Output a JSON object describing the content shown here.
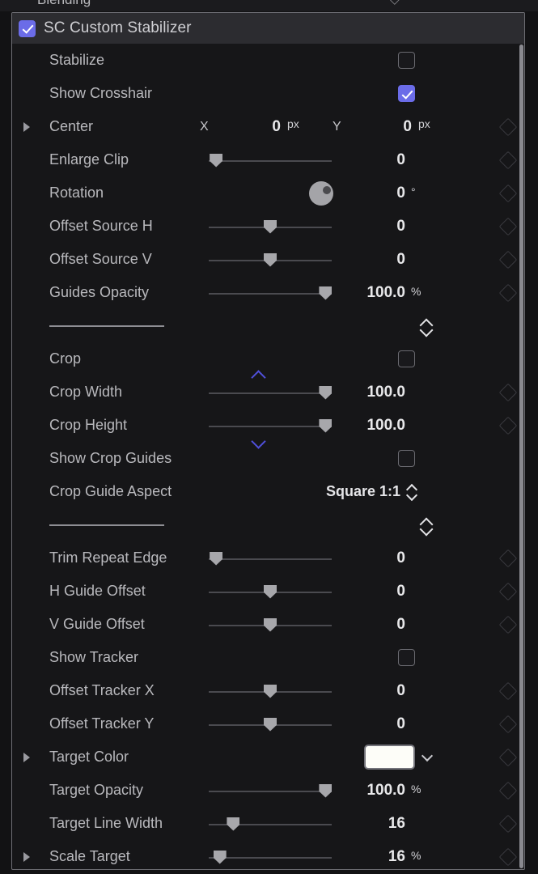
{
  "pre_row": {
    "label": "Blending",
    "keyframe_icon": "keyframe-diamond-icon"
  },
  "panel": {
    "title": "SC Custom Stabilizer",
    "enabled": true,
    "reset_icon": "reset-arrow-icon",
    "stepper_icon": "up-down-stepper-icon",
    "keyframe_icon": "keyframe-diamond-icon",
    "disclosure_icon": "disclosure-triangle-icon",
    "colors": {
      "accent_blue": "#6b6ce8",
      "drag_chevron_blue": "#4f4fd8",
      "header_bg": "#2c2c30",
      "panel_bg": "#161618",
      "label_text": "#b9b9bd",
      "value_text": "#e8e8ea",
      "slider_handle": "#a7a7ab",
      "swatch_white": "#fdfdf8"
    }
  },
  "rows": [
    {
      "id": "stabilize",
      "label": "Stabilize",
      "type": "checkbox",
      "checked": false
    },
    {
      "id": "show-crosshair",
      "label": "Show Crosshair",
      "type": "checkbox",
      "checked": true
    },
    {
      "id": "center",
      "label": "Center",
      "type": "point",
      "disclosure": true,
      "x_axis": "X",
      "x_value": "0",
      "x_unit": "px",
      "y_axis": "Y",
      "y_value": "0",
      "y_unit": "px",
      "keyframe": true
    },
    {
      "id": "enlarge-clip",
      "label": "Enlarge Clip",
      "type": "slider",
      "value": "0",
      "unit": "",
      "fill": 0.06,
      "keyframe": true
    },
    {
      "id": "rotation",
      "label": "Rotation",
      "type": "dial",
      "value": "0",
      "unit": "°",
      "keyframe": true
    },
    {
      "id": "offset-source-h",
      "label": "Offset Source H",
      "type": "slider",
      "value": "0",
      "unit": "",
      "fill": 0.5,
      "keyframe": true
    },
    {
      "id": "offset-source-v",
      "label": "Offset Source V",
      "type": "slider",
      "value": "0",
      "unit": "",
      "fill": 0.5,
      "keyframe": true
    },
    {
      "id": "guides-opacity",
      "label": "Guides Opacity",
      "type": "slider",
      "value": "100.0",
      "unit": "%",
      "fill": 0.95,
      "keyframe": true
    },
    {
      "id": "divider-1",
      "label": "",
      "type": "divider"
    },
    {
      "id": "crop",
      "label": "Crop",
      "type": "checkbox",
      "checked": false
    },
    {
      "id": "crop-width",
      "label": "Crop Width",
      "type": "slider",
      "value": "100.0",
      "unit": "",
      "fill": 0.95,
      "keyframe": true,
      "drag_chevron": "up"
    },
    {
      "id": "crop-height",
      "label": "Crop Height",
      "type": "slider",
      "value": "100.0",
      "unit": "",
      "fill": 0.95,
      "keyframe": true,
      "drag_chevron": "down"
    },
    {
      "id": "show-crop-guides",
      "label": "Show Crop Guides",
      "type": "checkbox",
      "checked": false
    },
    {
      "id": "crop-guide-aspect",
      "label": "Crop Guide Aspect",
      "type": "dropdown",
      "value": "Square 1:1",
      "reset": true
    },
    {
      "id": "divider-2",
      "label": "",
      "type": "divider"
    },
    {
      "id": "trim-repeat-edge",
      "label": "Trim Repeat Edge",
      "type": "slider",
      "value": "0",
      "unit": "",
      "fill": 0.06,
      "keyframe": true
    },
    {
      "id": "h-guide-offset",
      "label": "H Guide Offset",
      "type": "slider",
      "value": "0",
      "unit": "",
      "fill": 0.5,
      "keyframe": true
    },
    {
      "id": "v-guide-offset",
      "label": "V Guide Offset",
      "type": "slider",
      "value": "0",
      "unit": "",
      "fill": 0.5,
      "keyframe": true
    },
    {
      "id": "show-tracker",
      "label": "Show Tracker",
      "type": "checkbox",
      "checked": false
    },
    {
      "id": "offset-tracker-x",
      "label": "Offset Tracker X",
      "type": "slider",
      "value": "0",
      "unit": "",
      "fill": 0.5,
      "keyframe": true
    },
    {
      "id": "offset-tracker-y",
      "label": "Offset Tracker Y",
      "type": "slider",
      "value": "0",
      "unit": "",
      "fill": 0.5,
      "keyframe": true
    },
    {
      "id": "target-color",
      "label": "Target Color",
      "type": "color",
      "swatch": "#fdfdf8",
      "disclosure": true,
      "keyframe": true
    },
    {
      "id": "target-opacity",
      "label": "Target Opacity",
      "type": "slider",
      "value": "100.0",
      "unit": "%",
      "fill": 0.95,
      "keyframe": true
    },
    {
      "id": "target-line-width",
      "label": "Target Line Width",
      "type": "slider",
      "value": "16",
      "unit": "",
      "fill": 0.2,
      "keyframe": true
    },
    {
      "id": "scale-target",
      "label": "Scale Target",
      "type": "slider",
      "value": "16",
      "unit": "%",
      "fill": 0.09,
      "keyframe": true,
      "disclosure": true
    }
  ]
}
